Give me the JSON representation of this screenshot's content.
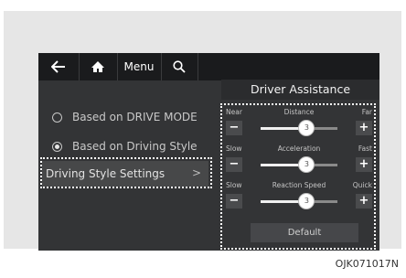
{
  "topbar": {
    "back_icon": "back-arrow-icon",
    "home_icon": "home-icon",
    "menu_label": "Menu",
    "search_icon": "search-icon"
  },
  "panel": {
    "title": "Driver Assistance"
  },
  "left_menu": {
    "option_drive_mode": "Based on DRIVE MODE",
    "option_driving_style": "Based on Driving Style",
    "selected": "Based on Driving Style",
    "style_settings": "Driving Style Settings",
    "style_settings_chevron": ">"
  },
  "sliders": [
    {
      "left": "Near",
      "label": "Distance",
      "right": "Far",
      "value": 3,
      "max": 5
    },
    {
      "left": "Slow",
      "label": "Acceleration",
      "right": "Fast",
      "value": 3,
      "max": 5
    },
    {
      "left": "Slow",
      "label": "Reaction Speed",
      "right": "Quick",
      "value": 3,
      "max": 5
    }
  ],
  "controls": {
    "minus": "−",
    "plus": "+"
  },
  "default_label": "Default",
  "figure_code": "OJK071017N"
}
